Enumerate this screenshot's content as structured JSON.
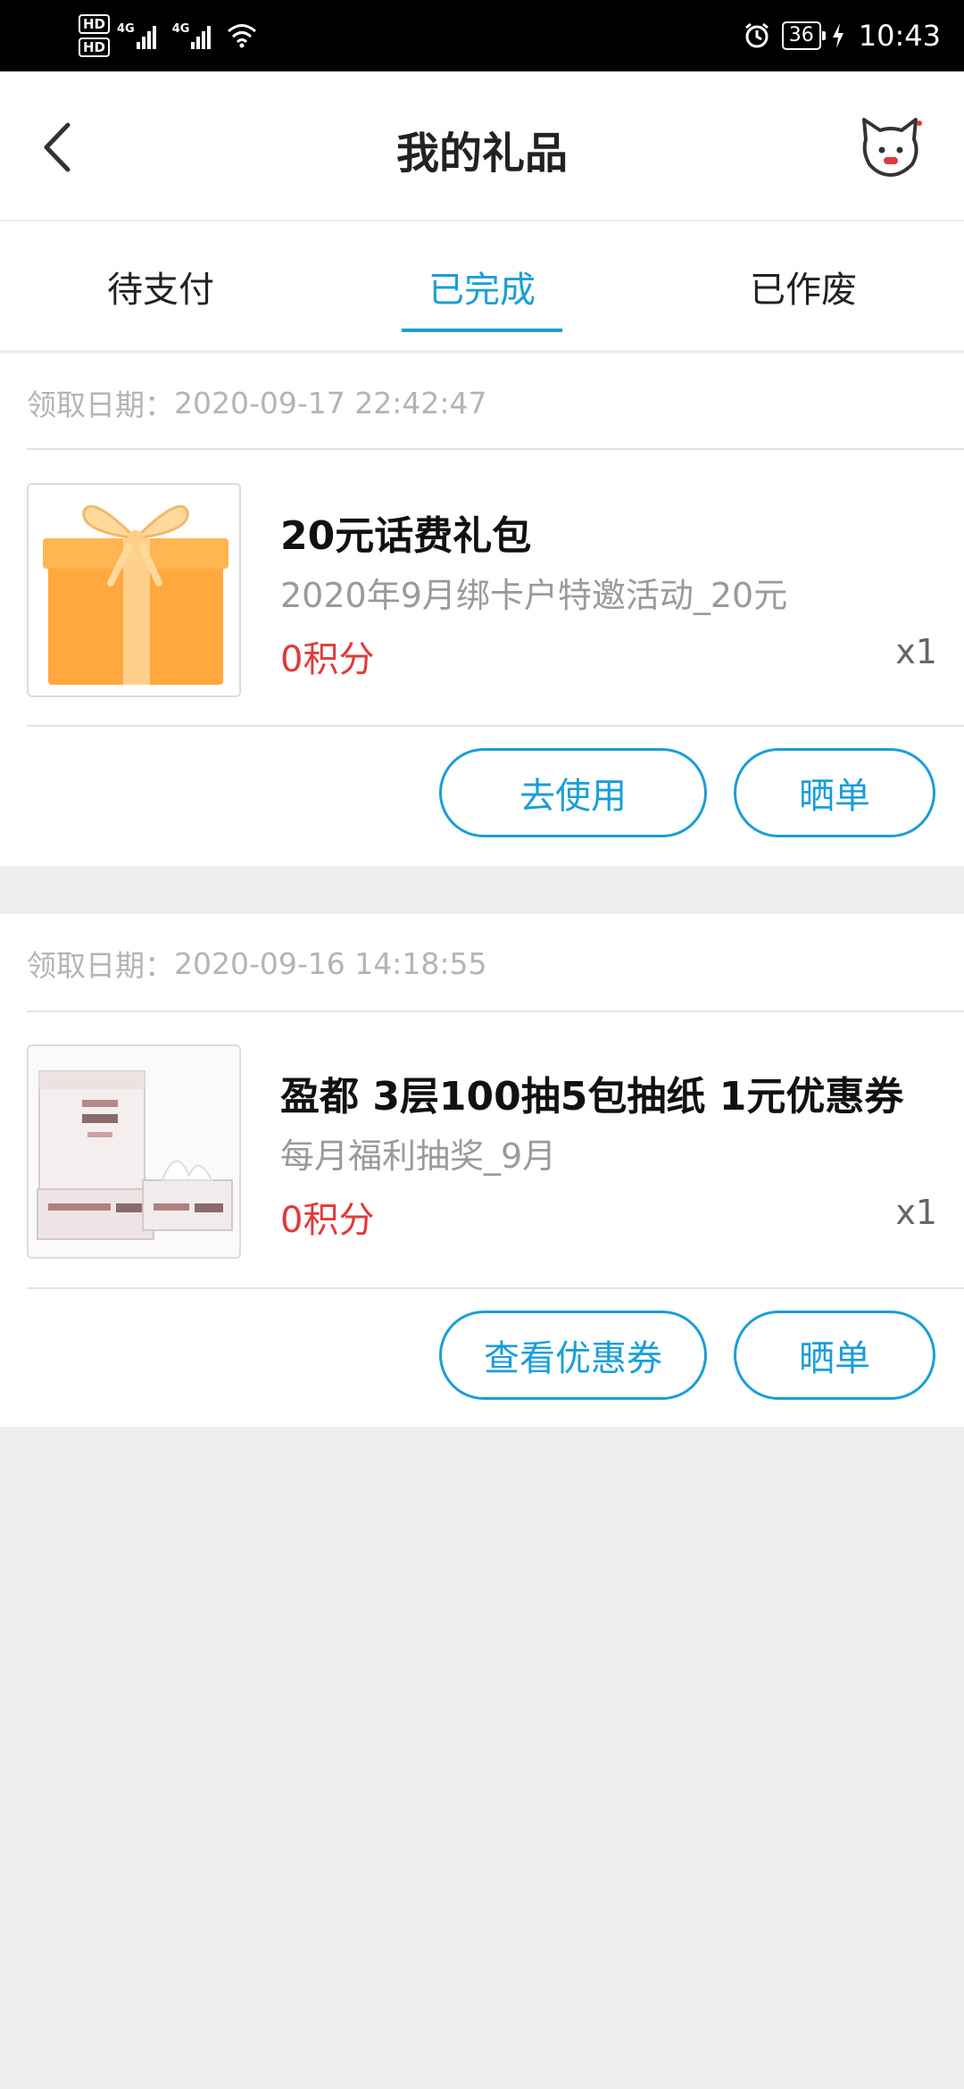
{
  "status_bar": {
    "hd1": "HD",
    "hd2": "HD",
    "net1": "4G",
    "net2": "4G",
    "battery": "36",
    "time": "10:43",
    "icons": [
      "signal-icon",
      "wifi-icon",
      "alarm-icon",
      "battery-icon",
      "charging-icon"
    ]
  },
  "header": {
    "title": "我的礼品",
    "back_icon": "back-arrow-icon",
    "mascot_icon": "cat-mascot-icon"
  },
  "tabs": [
    {
      "label": "待支付",
      "active": false
    },
    {
      "label": "已完成",
      "active": true
    },
    {
      "label": "已作废",
      "active": false
    }
  ],
  "colors": {
    "accent": "#1a9ed8",
    "points": "#e03a3a",
    "muted": "#b4b4b4",
    "background": "#efefef"
  },
  "gifts": [
    {
      "date_label": "领取日期：",
      "date": "2020-09-17 22:42:47",
      "image": "gift-box-image",
      "name": "20元话费礼包",
      "desc": "2020年9月绑卡户特邀活动_20元",
      "points": "0积分",
      "qty": "x1",
      "buttons": [
        "去使用",
        "晒单"
      ]
    },
    {
      "date_label": "领取日期：",
      "date": "2020-09-16 14:18:55",
      "image": "tissue-pack-image",
      "name": "盈都 3层100抽5包抽纸 1元优惠券",
      "desc": "每月福利抽奖_9月",
      "points": "0积分",
      "qty": "x1",
      "buttons": [
        "查看优惠券",
        "晒单"
      ]
    }
  ]
}
